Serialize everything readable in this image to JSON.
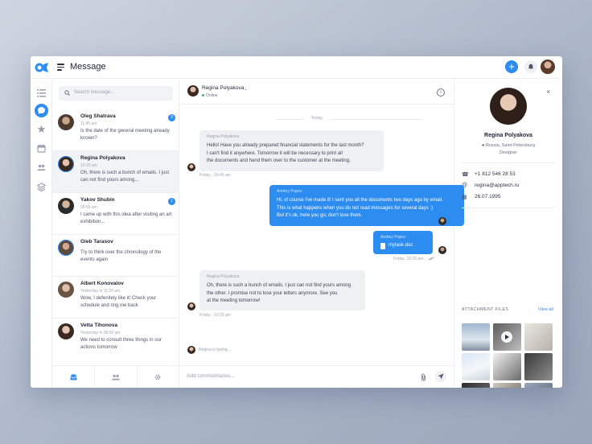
{
  "app": {
    "title": "Message",
    "accent": "#2d8cf0"
  },
  "topbar": {
    "add_icon": "plus-icon",
    "add_label": "+",
    "bell_icon": "bell-icon"
  },
  "rail": {
    "items": [
      "list-icon",
      "chat-icon",
      "star-icon",
      "calendar-icon",
      "people-icon",
      "layers-icon"
    ],
    "active": "chat-icon"
  },
  "search": {
    "placeholder": "Search message..."
  },
  "conversations": [
    {
      "name": "Oleg Shatrava",
      "time": "11:45 am",
      "preview": "Is the date of the general meeting already known?",
      "badge": "3"
    },
    {
      "name": "Regina Polyakova",
      "time": "10:25 am",
      "preview": "Oh, there is such a bunch of emails. I just can not find yours among...",
      "active": true
    },
    {
      "name": "Yakov Shubin",
      "time": "09:55 am",
      "preview": "I came up with this idea after visiting an art exhibition...",
      "badge": "1"
    },
    {
      "name": "Gleb Tarasov",
      "time": "",
      "preview": "Try to think over the chronology of the events again"
    },
    {
      "name": "Albert Konovalov",
      "time": "Yesterday in 11:20 am",
      "preview": "Wow, I defenitely like it! Check your schedule and ring me back"
    },
    {
      "name": "Vetta Tihonova",
      "time": "Yesterday in 08:00 am",
      "preview": "We need to consult three things in our actions tomorrow"
    }
  ],
  "list_footer": [
    "inbox-icon",
    "group-icon",
    "settings-icon"
  ],
  "chat": {
    "contact_name": "Regina Polyakova",
    "contact_status": "Online",
    "day_label": "Today",
    "messages": [
      {
        "from": "Regina Polyakova",
        "direction": "in",
        "lines": [
          "Hello! Have you already prepared financial statements for the last month?",
          "I can't find it anywhere. Tomorrow it will be necessary to print all",
          "the documents and hand them over to the customer at the meeting."
        ],
        "time": "Friday , 09:45 am"
      },
      {
        "from": "Andrey Popov",
        "direction": "out",
        "lines": [
          "Hi, of course I've made it! I sent you all the documents two days ago by email.",
          "This is what happens when you do not read messages for several days :)",
          "But it's ok, here you go, don't lose them."
        ]
      },
      {
        "from": "Andrey Popov",
        "direction": "out",
        "attachment": "mytask.doc",
        "time": "Friday ,10:15 am"
      },
      {
        "from": "Regina Polyakova",
        "direction": "in",
        "lines": [
          "Oh, there is such a bunch of emails. I just can not find yours among",
          "the other. I promise not to lose your letters anymore. See you",
          "at the meeting tomorrow!"
        ],
        "time": "Friday , 10:25 am"
      }
    ],
    "typing": "Regina is typing...",
    "composer_placeholder": "Add commentaries..."
  },
  "profile": {
    "name": "Regina Polyakova",
    "location": "Russia, Saint-Petersburg",
    "role": "Designer",
    "phone": "+1 812 546 28 53",
    "email": "regina@apptech.ru",
    "birthday": "26.07.1995",
    "attachments_title": "ATTACHMENT FILES",
    "view_all": "View all",
    "thumbnails": [
      "image",
      "video",
      "image",
      "image",
      "video",
      "image",
      "video",
      "image",
      "image"
    ]
  }
}
